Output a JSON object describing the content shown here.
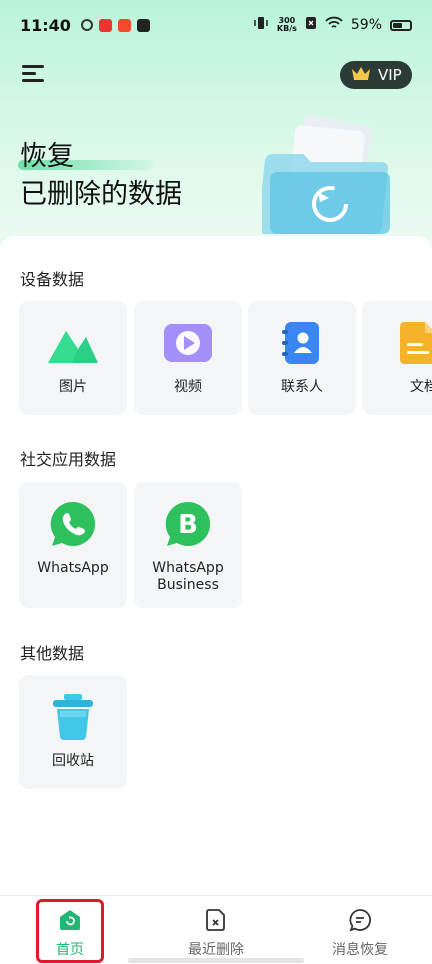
{
  "status_bar": {
    "time": "11:40",
    "net_speed_value": "300",
    "net_speed_unit": "KB/s",
    "battery_percent": "59%",
    "battery_level": 0.59
  },
  "header": {
    "vip_label": "VIP"
  },
  "hero": {
    "title_line1": "恢复",
    "title_line2": "已删除的数据"
  },
  "sections": {
    "device": {
      "title": "设备数据",
      "items": [
        {
          "label": "图片"
        },
        {
          "label": "视频"
        },
        {
          "label": "联系人"
        },
        {
          "label": "文档"
        }
      ]
    },
    "social": {
      "title": "社交应用数据",
      "items": [
        {
          "label": "WhatsApp"
        },
        {
          "label_line1": "WhatsApp",
          "label_line2": "Business"
        }
      ]
    },
    "other": {
      "title": "其他数据",
      "items": [
        {
          "label": "回收站"
        }
      ]
    }
  },
  "bottom_nav": {
    "items": [
      {
        "label": "首页",
        "active": true
      },
      {
        "label": "最近删除",
        "active": false
      },
      {
        "label": "消息恢复",
        "active": false
      }
    ]
  },
  "colors": {
    "accent": "#22b573",
    "whatsapp": "#2fc05e",
    "video": "#9f8cff",
    "contacts": "#3a86f2",
    "docs": "#f7b22a",
    "recycle": "#41c7e8",
    "highlight_box": "#e0192a"
  }
}
